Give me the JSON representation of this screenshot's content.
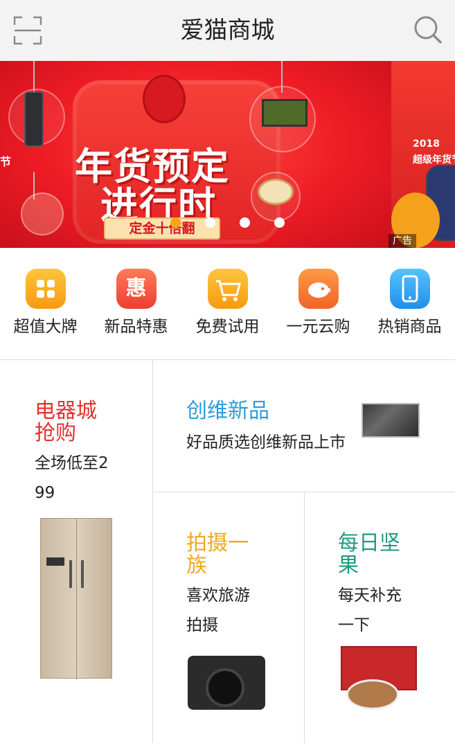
{
  "header": {
    "title": "爱猫商城",
    "left_icon": "scan-icon",
    "right_icon": "search-icon"
  },
  "banner": {
    "headline_1": "年货预定",
    "headline_2": "进行时",
    "ribbon": "定金十倍翻",
    "ad_label": "广告",
    "next_slide_year": "2018",
    "next_slide_text": "超级年货节",
    "prev_slide_text": "节",
    "slide_count": 4,
    "active_slide": 1
  },
  "categories": [
    {
      "label": "超值大牌",
      "icon": "four-squares-icon",
      "color": "#f8a91c"
    },
    {
      "label": "新品特惠",
      "icon": "hui-icon",
      "color": "#f0553d"
    },
    {
      "label": "免费试用",
      "icon": "shopping-cart-icon",
      "color": "#f7a51e"
    },
    {
      "label": "一元云购",
      "icon": "piggy-bank-icon",
      "color": "#f37a2f"
    },
    {
      "label": "热销商品",
      "icon": "phone-icon",
      "color": "#2ba3f0"
    }
  ],
  "tiles": {
    "appliances": {
      "title_1": "电器城",
      "title_2": "抢购",
      "sub_1": "全场低至2",
      "sub_2": "99",
      "title_color": "#e63030"
    },
    "skyworth": {
      "title": "创维新品",
      "sub": "好品质选创维新品上市",
      "title_color": "#2b9bd9"
    },
    "photo": {
      "title_1": "拍摄一",
      "title_2": "族",
      "sub_1": "喜欢旅游",
      "sub_2": "拍摄",
      "title_color": "#f0a820"
    },
    "nuts": {
      "title_1": "每日坚",
      "title_2": "果",
      "sub_1": "每天补充",
      "sub_2": "一下",
      "title_color": "#1e9a82"
    }
  }
}
